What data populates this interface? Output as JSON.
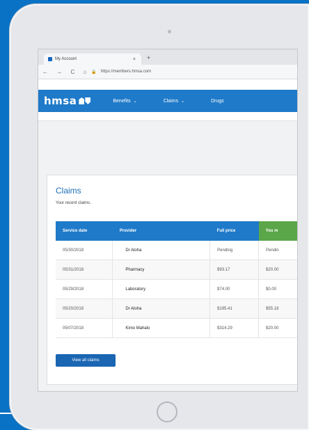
{
  "browser": {
    "tab_title": "My Account",
    "tab_close": "×",
    "new_tab": "+",
    "nav_buttons": "← → C ⌂",
    "url": "https://members.hmsa.com"
  },
  "site": {
    "logo": "hmsa",
    "menu": [
      {
        "label": "Benefits",
        "chevron": "⌄"
      },
      {
        "label": "Claims",
        "chevron": "⌄"
      },
      {
        "label": "Drugs",
        "chevron": ""
      }
    ]
  },
  "claims": {
    "title": "Claims",
    "subtitle": "Your recent claims.",
    "columns": [
      "Service date",
      "Provider",
      "Full price",
      "You m"
    ],
    "rows": [
      [
        "05/30/2018",
        "Dr Aloha",
        "Pending",
        "Pendin"
      ],
      [
        "05/31/2018",
        "Pharmacy",
        "$93.17",
        "$20.00"
      ],
      [
        "05/29/2018",
        "Laboratory",
        "$74.00",
        "$0.00"
      ],
      [
        "05/20/2018",
        "Dr Aloha",
        "$195.41",
        "$55.18"
      ],
      [
        "05/07/2018",
        "Kimo Mahalo",
        "$314.29",
        "$20.00"
      ]
    ],
    "view_all": "View all claims"
  }
}
